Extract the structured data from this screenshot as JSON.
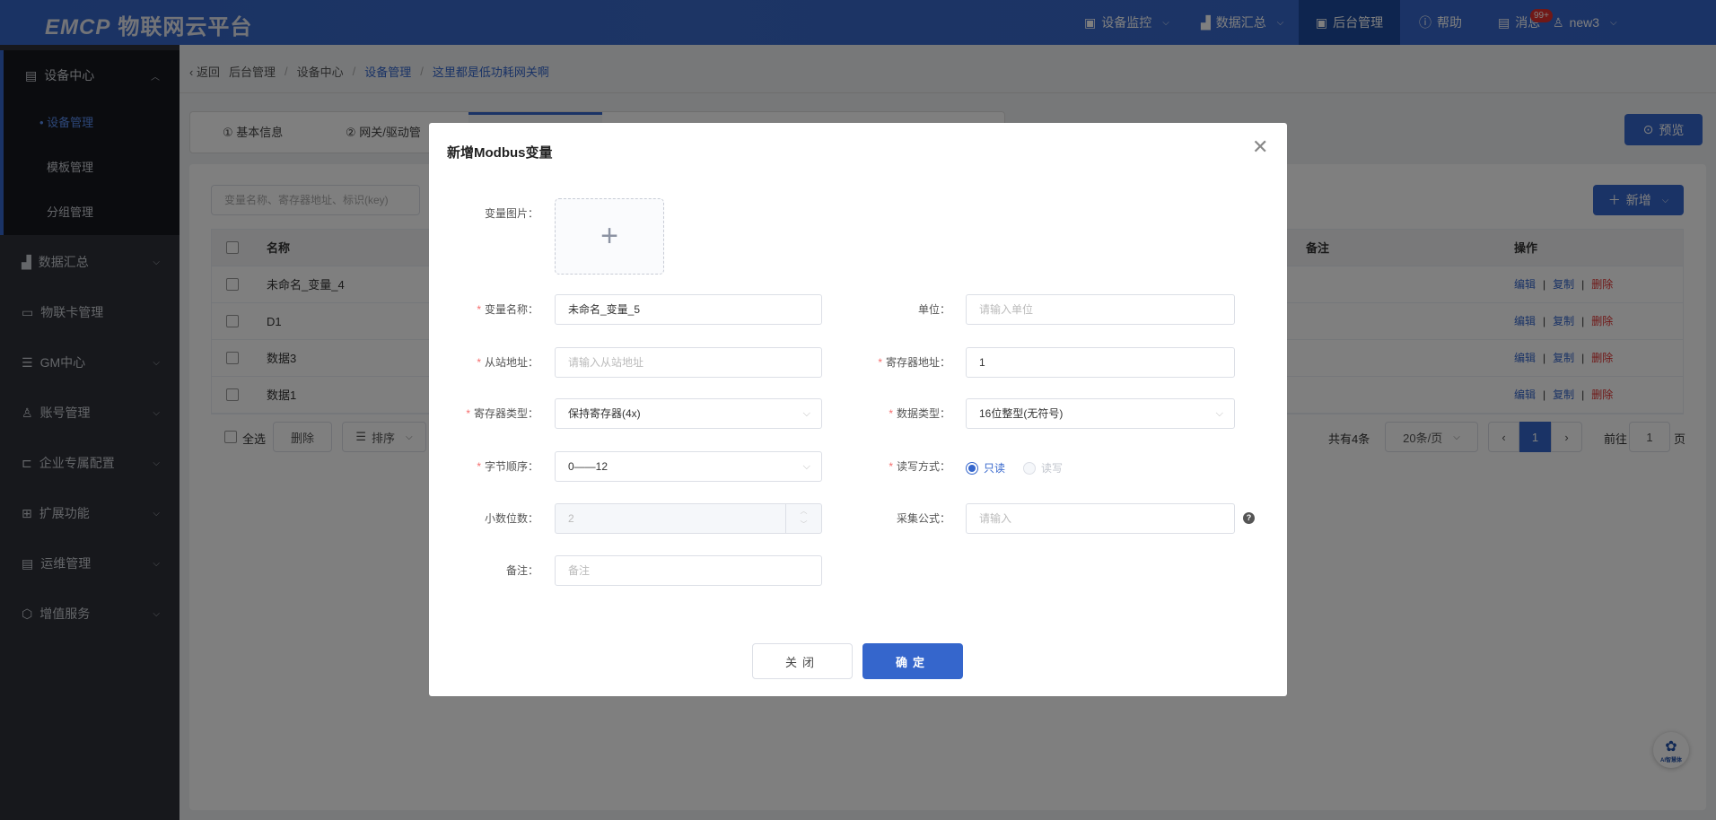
{
  "header": {
    "logo": "EMCP",
    "logo_sub": "物联网云平台",
    "nav": [
      {
        "label": "设备监控"
      },
      {
        "label": "数据汇总"
      },
      {
        "label": "后台管理"
      },
      {
        "label": "帮助"
      },
      {
        "label": "消息",
        "badge": "99+"
      },
      {
        "label": "new3"
      }
    ]
  },
  "sidebar": {
    "section": "设备中心",
    "sub": [
      "设备管理",
      "模板管理",
      "分组管理"
    ],
    "items": [
      "数据汇总",
      "物联卡管理",
      "GM中心",
      "账号管理",
      "企业专属配置",
      "扩展功能",
      "运维管理",
      "增值服务"
    ]
  },
  "breadcrumb": {
    "back": "返回",
    "items": [
      "后台管理",
      "设备中心",
      "设备管理",
      "这里都是低功耗网关啊"
    ]
  },
  "tabs": [
    "① 基本信息",
    "② 网关/驱动管"
  ],
  "preview_label": "预览",
  "search_placeholder": "变量名称、寄存器地址、标识(key)",
  "add_label": "新增",
  "table": {
    "headers": {
      "name": "名称",
      "remark": "备注",
      "ops": "操作"
    },
    "rows": [
      {
        "name": "未命名_变量_4"
      },
      {
        "name": "D1"
      },
      {
        "name": "数据3"
      },
      {
        "name": "数据1"
      }
    ],
    "ops": {
      "edit": "编辑",
      "copy": "复制",
      "del": "删除"
    }
  },
  "footer": {
    "select_all": "全选",
    "delete": "删除",
    "sort": "排序",
    "total": "共有4条",
    "page_size": "20条/页",
    "current_page": "1",
    "goto": "前往",
    "goto_value": "1",
    "page_unit": "页"
  },
  "modal": {
    "title": "新增Modbus变量",
    "image_label": "变量图片：",
    "name_label": "变量名称：",
    "name_value": "未命名_变量_5",
    "unit_label": "单位：",
    "unit_placeholder": "请输入单位",
    "slave_label": "从站地址：",
    "slave_placeholder": "请输入从站地址",
    "reg_addr_label": "寄存器地址：",
    "reg_addr_value": "1",
    "reg_type_label": "寄存器类型：",
    "reg_type_value": "保持寄存器(4x)",
    "data_type_label": "数据类型：",
    "data_type_value": "16位整型(无符号)",
    "byte_order_label": "字节顺序：",
    "byte_order_value": "0——12",
    "rw_label": "读写方式：",
    "rw_options": [
      "只读",
      "读写"
    ],
    "decimals_label": "小数位数：",
    "decimals_value": "2",
    "formula_label": "采集公式：",
    "formula_placeholder": "请输入",
    "remark_label": "备注：",
    "remark_placeholder": "备注",
    "close": "关闭",
    "confirm": "确定"
  },
  "fab_label": "AI智慧体",
  "colors": {
    "primary": "#3566cc",
    "danger": "#e0302e"
  }
}
